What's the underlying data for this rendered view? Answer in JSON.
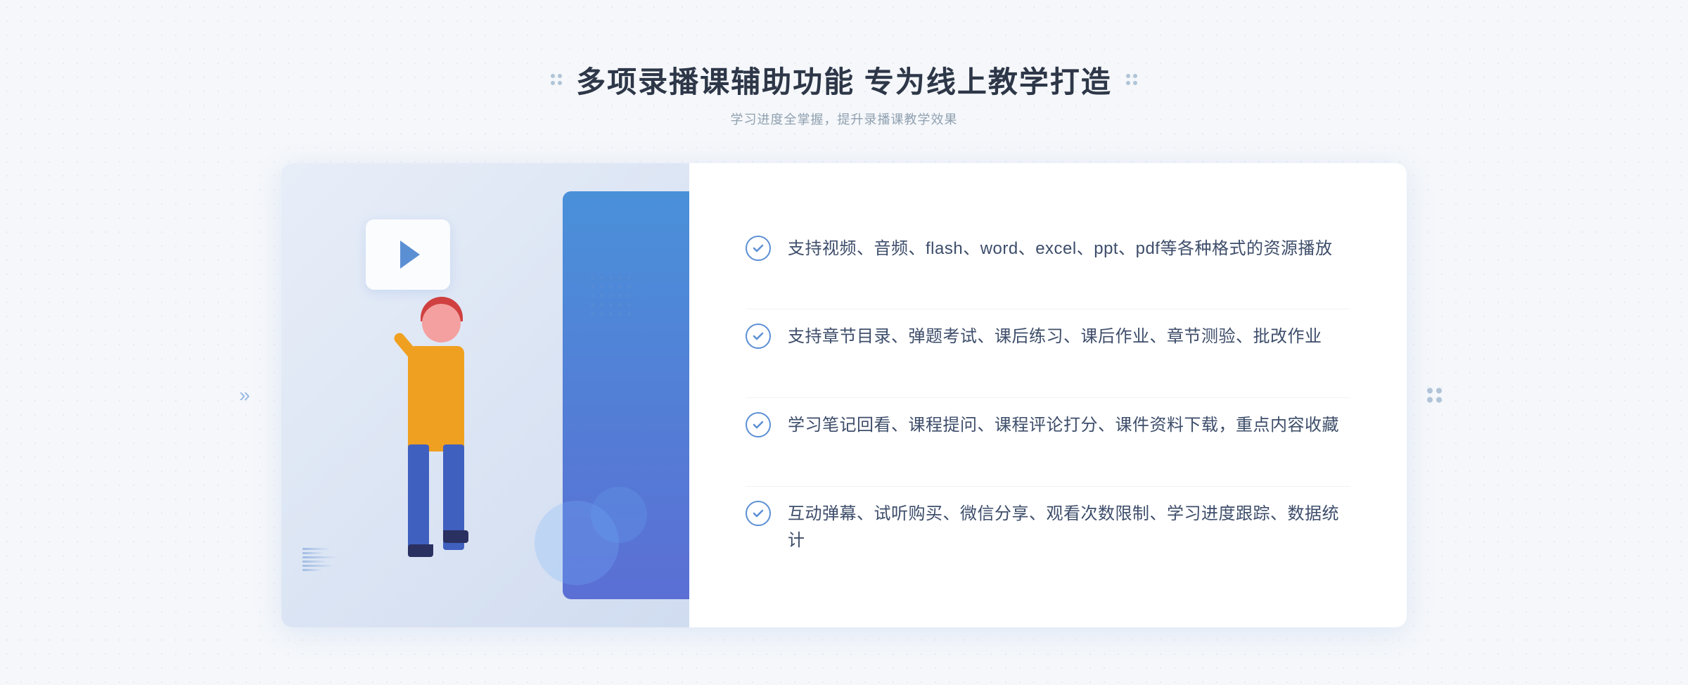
{
  "header": {
    "title": "多项录播课辅助功能 专为线上教学打造",
    "subtitle": "学习进度全掌握，提升录播课教学效果"
  },
  "features": [
    {
      "id": "feature-1",
      "text": "支持视频、音频、flash、word、excel、ppt、pdf等各种格式的资源播放"
    },
    {
      "id": "feature-2",
      "text": "支持章节目录、弹题考试、课后练习、课后作业、章节测验、批改作业"
    },
    {
      "id": "feature-3",
      "text": "学习笔记回看、课程提问、课程评论打分、课件资料下载，重点内容收藏"
    },
    {
      "id": "feature-4",
      "text": "互动弹幕、试听购买、微信分享、观看次数限制、学习进度跟踪、数据统计"
    }
  ],
  "colors": {
    "accent": "#5b8fd4",
    "text_primary": "#3d4d6a",
    "text_secondary": "#90a0b0",
    "title": "#2d3748"
  },
  "decorators": {
    "left_arrows": "≫",
    "right_dots": true
  }
}
